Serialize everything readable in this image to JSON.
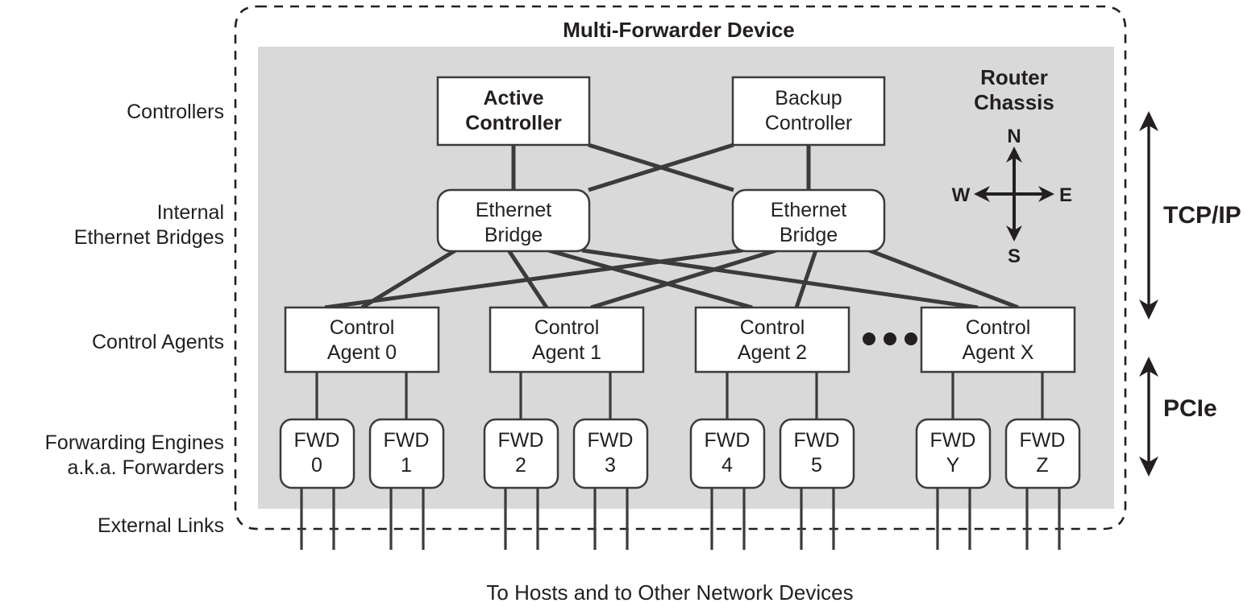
{
  "title": "Multi-Forwarder Device",
  "chassis_label_line1": "Router",
  "chassis_label_line2": "Chassis",
  "caption": "To Hosts and to Other Network Devices",
  "row_labels": [
    {
      "id": "controllers",
      "text": "Controllers",
      "lines": [
        "Controllers"
      ]
    },
    {
      "id": "bridges",
      "text": "Internal Ethernet Bridges",
      "lines": [
        "Internal",
        "Ethernet Bridges"
      ]
    },
    {
      "id": "agents",
      "text": "Control Agents",
      "lines": [
        "Control Agents"
      ]
    },
    {
      "id": "forwarders",
      "text": "Forwarding Engines a.k.a. Forwarders",
      "lines": [
        "Forwarding Engines",
        "a.k.a. Forwarders"
      ]
    },
    {
      "id": "external",
      "text": "External Links",
      "lines": [
        "External Links"
      ]
    }
  ],
  "controllers": [
    {
      "id": "active-controller",
      "lines": [
        "Active",
        "Controller"
      ],
      "bold": true
    },
    {
      "id": "backup-controller",
      "lines": [
        "Backup",
        "Controller"
      ],
      "bold": false
    }
  ],
  "bridges": [
    {
      "id": "ethernet-bridge-left",
      "lines": [
        "Ethernet",
        "Bridge"
      ]
    },
    {
      "id": "ethernet-bridge-right",
      "lines": [
        "Ethernet",
        "Bridge"
      ]
    }
  ],
  "control_agents": [
    {
      "id": "control-agent-0",
      "lines": [
        "Control",
        "Agent 0"
      ]
    },
    {
      "id": "control-agent-1",
      "lines": [
        "Control",
        "Agent 1"
      ]
    },
    {
      "id": "control-agent-2",
      "lines": [
        "Control",
        "Agent 2"
      ]
    },
    {
      "id": "control-agent-x",
      "lines": [
        "Control",
        "Agent X"
      ]
    }
  ],
  "forwarders": [
    {
      "id": "fwd-0",
      "lines": [
        "FWD",
        "0"
      ]
    },
    {
      "id": "fwd-1",
      "lines": [
        "FWD",
        "1"
      ]
    },
    {
      "id": "fwd-2",
      "lines": [
        "FWD",
        "2"
      ]
    },
    {
      "id": "fwd-3",
      "lines": [
        "FWD",
        "3"
      ]
    },
    {
      "id": "fwd-4",
      "lines": [
        "FWD",
        "4"
      ]
    },
    {
      "id": "fwd-5",
      "lines": [
        "FWD",
        "5"
      ]
    },
    {
      "id": "fwd-y",
      "lines": [
        "FWD",
        "Y"
      ]
    },
    {
      "id": "fwd-z",
      "lines": [
        "FWD",
        "Z"
      ]
    }
  ],
  "bus_labels": [
    {
      "id": "tcpip",
      "text": "TCP/IP"
    },
    {
      "id": "pcie",
      "text": "PCIe"
    }
  ],
  "compass": {
    "north": "N",
    "south": "S",
    "east": "E",
    "west": "W"
  },
  "ellipsis": "• • •",
  "colors": {
    "chassis_fill": "#d9d9d9",
    "box_fill": "#ffffff",
    "line": "#3b3b3b",
    "text": "#231f20",
    "background": "#ffffff"
  }
}
